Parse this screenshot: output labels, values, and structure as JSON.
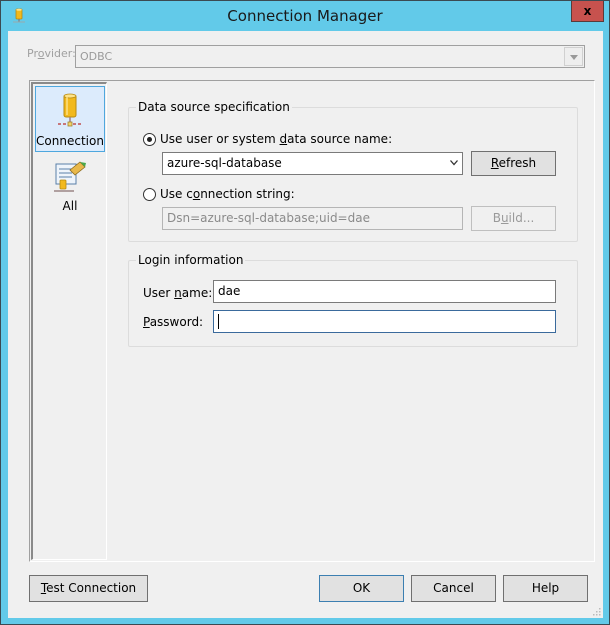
{
  "window": {
    "title": "Connection Manager",
    "close_label": "x",
    "colors": {
      "titlebar": "#62cae9",
      "close": "#c7524e",
      "accent": "#4ea7de"
    }
  },
  "provider": {
    "label_pre": "Pr",
    "label_u": "o",
    "label_post": "vider:",
    "value": "ODBC"
  },
  "sidebar": {
    "items": [
      {
        "label": "Connection",
        "icon": "database-icon",
        "selected": true
      },
      {
        "label": "All",
        "icon": "properties-icon",
        "selected": false
      }
    ]
  },
  "data_source": {
    "group_title": "Data source specification",
    "radio_dsn": {
      "pre": "Use user or system ",
      "u": "d",
      "post": "ata source name:",
      "checked": true
    },
    "dsn_value": "azure-sql-database",
    "refresh": {
      "u": "R",
      "post": "efresh"
    },
    "radio_connstr": {
      "pre": "Use c",
      "u": "o",
      "post": "nnection string:",
      "checked": false
    },
    "connstr_value": "Dsn=azure-sql-database;uid=dae",
    "build": {
      "pre": "B",
      "u": "u",
      "post": "ild..."
    }
  },
  "login": {
    "group_title": "Login information",
    "username_label": {
      "pre": "User ",
      "u": "n",
      "post": "ame:"
    },
    "username_value": "dae",
    "password_label": {
      "pre": "",
      "u": "P",
      "post": "assword:"
    },
    "password_value": ""
  },
  "footer": {
    "test": {
      "u": "T",
      "post": "est Connection"
    },
    "ok": "OK",
    "cancel": "Cancel",
    "help": "Help"
  }
}
